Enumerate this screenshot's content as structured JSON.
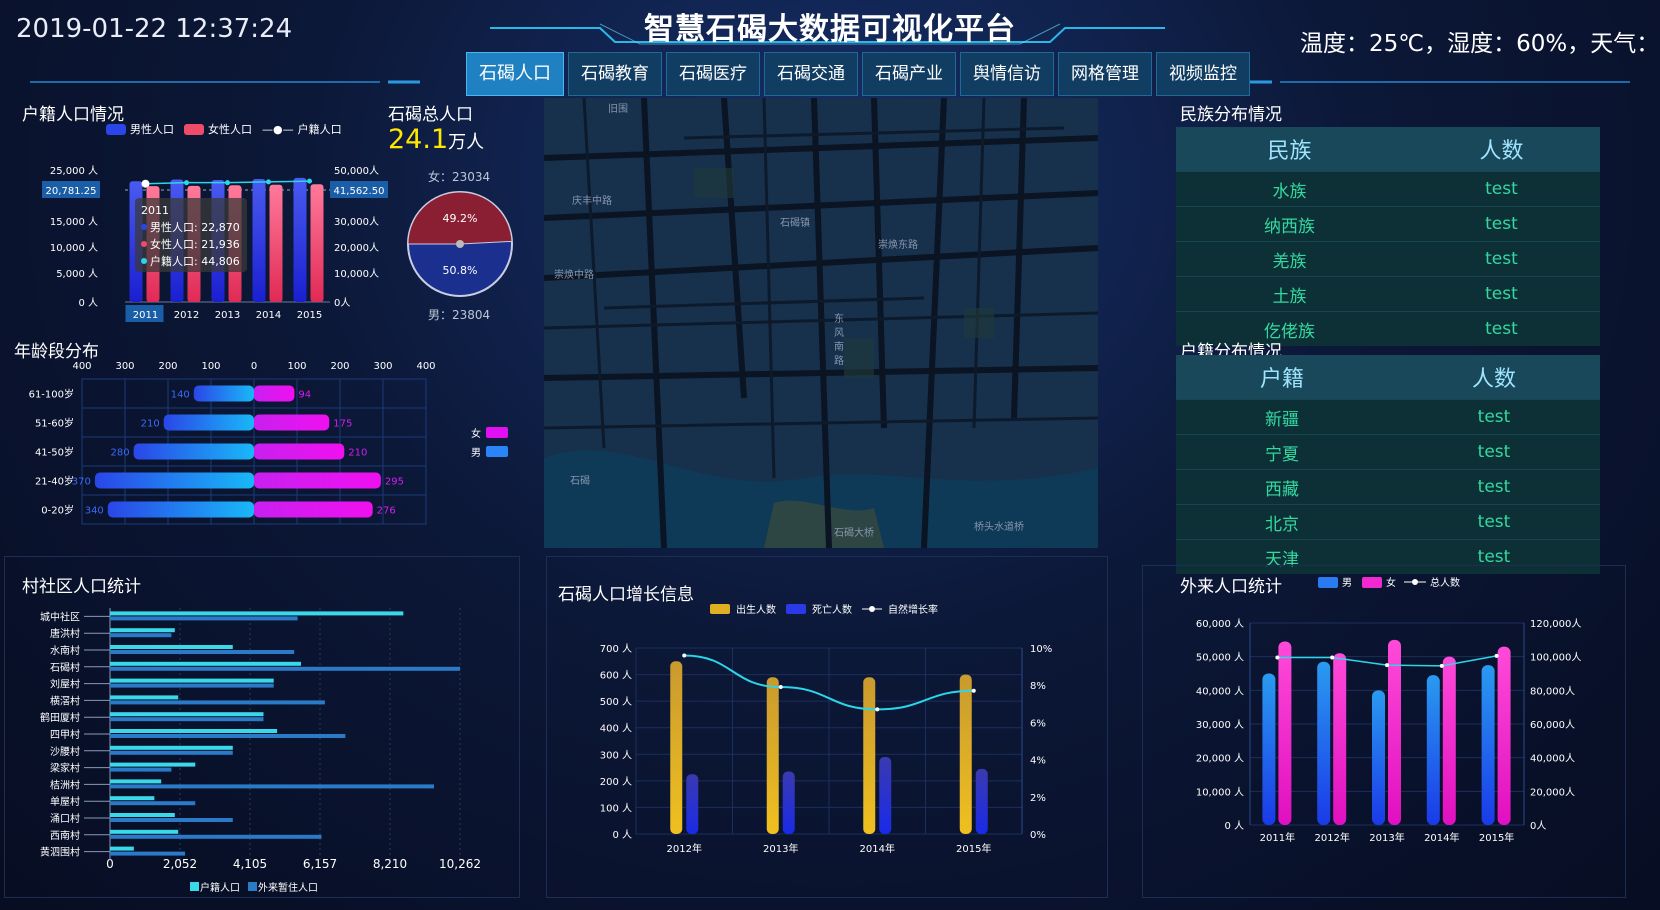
{
  "header": {
    "datetime": "2019-01-22 12:37:24",
    "title": "智慧石碣大数据可视化平台",
    "weather": "温度：25℃，湿度：60%，天气：",
    "tabs": [
      "石碣人口",
      "石碣教育",
      "石碣医疗",
      "石碣交通",
      "石碣产业",
      "舆情信访",
      "网格管理",
      "视频监控"
    ],
    "active_tab": 0
  },
  "colors": {
    "accent": "#1f80c2",
    "male": "#2a46e8",
    "female": "#ef4c6a",
    "cyan": "#2ad6e8",
    "table_green": "#33d9a0"
  },
  "household": {
    "title": "户籍人口情况",
    "legend": [
      "男性人口",
      "女性人口",
      "户籍人口"
    ],
    "left_ticks": [
      "25,000 人",
      "20,781.25",
      "15,000 人",
      "10,000 人",
      "5,000 人",
      "0 人"
    ],
    "right_ticks": [
      "50,000人",
      "41,562.50",
      "30,000人",
      "20,000人",
      "10,000人",
      "0人"
    ],
    "tooltip": {
      "year": "2011",
      "male": "男性人口: 22,870",
      "female": "女性人口: 21,936",
      "total": "户籍人口: 44,806"
    },
    "chart_data": {
      "type": "bar",
      "categories": [
        "2011",
        "2012",
        "2013",
        "2014",
        "2015"
      ],
      "series": [
        {
          "name": "男性人口",
          "values": [
            22870,
            23200,
            23100,
            23300,
            23500
          ]
        },
        {
          "name": "女性人口",
          "values": [
            21936,
            22000,
            22100,
            22200,
            22300
          ]
        },
        {
          "name": "户籍人口",
          "values": [
            44806,
            45200,
            45200,
            45500,
            45800
          ]
        }
      ],
      "ylim": [
        0,
        25000
      ],
      "y2lim": [
        0,
        50000
      ]
    }
  },
  "total_pop": {
    "title": "石碣总人口",
    "value": "24.1",
    "unit": "万人",
    "female_label": "女：23034",
    "male_label": "男：23804",
    "chart_data": {
      "type": "pie",
      "labels": [
        "女",
        "男"
      ],
      "values": [
        49.2,
        50.8
      ],
      "value_labels": [
        "49.2%",
        "50.8%"
      ]
    }
  },
  "age": {
    "title": "年龄段分布",
    "legend": [
      "女",
      "男"
    ],
    "axis_ticks": [
      "400",
      "300",
      "200",
      "100",
      "0",
      "100",
      "200",
      "300",
      "400"
    ],
    "chart_data": {
      "type": "bar",
      "categories": [
        "61-100岁",
        "51-60岁",
        "41-50岁",
        "21-40岁",
        "0-20岁"
      ],
      "series": [
        {
          "name": "男",
          "values": [
            140,
            210,
            280,
            370,
            340
          ]
        },
        {
          "name": "女",
          "values": [
            94,
            175,
            210,
            295,
            276
          ]
        }
      ],
      "xlim": [
        -400,
        400
      ]
    }
  },
  "ethnic": {
    "title": "民族分布情况",
    "headers": [
      "民族",
      "人数"
    ],
    "rows": [
      [
        "水族",
        "test"
      ],
      [
        "纳西族",
        "test"
      ],
      [
        "羌族",
        "test"
      ],
      [
        "土族",
        "test"
      ],
      [
        "仡佬族",
        "test"
      ]
    ]
  },
  "huji": {
    "title": "户籍分布情况",
    "headers": [
      "户籍",
      "人数"
    ],
    "rows": [
      [
        "新疆",
        "test"
      ],
      [
        "宁夏",
        "test"
      ],
      [
        "西藏",
        "test"
      ],
      [
        "北京",
        "test"
      ],
      [
        "天津",
        "test"
      ]
    ]
  },
  "map": {
    "labels": [
      "旧围",
      "庆丰中路",
      "石碣镇",
      "崇焕东路",
      "崇焕中路",
      "东风南路",
      "石碣",
      "石碣大桥",
      "桥头水道桥"
    ]
  },
  "village": {
    "title": "村社区人口统计",
    "legend": [
      "户籍人口",
      "外来暂住人口"
    ],
    "axis_ticks": [
      "0",
      "2,052",
      "4,105",
      "6,157",
      "8,210",
      "10,262"
    ],
    "chart_data": {
      "type": "bar",
      "categories": [
        "城中社区",
        "唐洪村",
        "水南村",
        "石碣村",
        "刘屋村",
        "横滘村",
        "鹤田厦村",
        "四甲村",
        "沙腰村",
        "梁家村",
        "桔洲村",
        "单屋村",
        "涌口村",
        "西南村",
        "黄泗围村"
      ],
      "series": [
        {
          "name": "户籍人口",
          "values": [
            8600,
            1900,
            3600,
            5600,
            4800,
            2000,
            4500,
            4900,
            3600,
            2500,
            1500,
            1300,
            1900,
            2000,
            700
          ]
        },
        {
          "name": "外来暂住人口",
          "values": [
            5500,
            1800,
            5400,
            10262,
            4800,
            6300,
            4500,
            6900,
            3600,
            1800,
            9500,
            2500,
            3600,
            6200,
            2200
          ]
        }
      ],
      "xlim": [
        0,
        10262
      ]
    }
  },
  "growth": {
    "title": "石碣人口增长信息",
    "legend": [
      "出生人数",
      "死亡人数",
      "自然增长率"
    ],
    "left_ticks": [
      "700 人",
      "600 人",
      "500 人",
      "400 人",
      "300 人",
      "200 人",
      "100 人",
      "0 人"
    ],
    "right_ticks": [
      "10%",
      "8%",
      "6%",
      "4%",
      "2%",
      "0%"
    ],
    "chart_data": {
      "type": "bar",
      "categories": [
        "2012年",
        "2013年",
        "2014年",
        "2015年"
      ],
      "series": [
        {
          "name": "出生人数",
          "values": [
            650,
            590,
            590,
            600
          ]
        },
        {
          "name": "死亡人数",
          "values": [
            225,
            235,
            290,
            245
          ]
        },
        {
          "name": "自然增长率",
          "values": [
            9.6,
            7.9,
            6.7,
            7.7
          ]
        }
      ],
      "ylim": [
        0,
        700
      ],
      "y2lim": [
        0,
        10
      ]
    }
  },
  "migrant": {
    "title": "外来人口统计",
    "legend": [
      "男",
      "女",
      "总人数"
    ],
    "left_ticks": [
      "60,000 人",
      "50,000 人",
      "40,000 人",
      "30,000 人",
      "20,000 人",
      "10,000 人",
      "0 人"
    ],
    "right_ticks": [
      "120,000人",
      "100,000人",
      "80,000人",
      "60,000人",
      "40,000人",
      "20,000人",
      "0人"
    ],
    "chart_data": {
      "type": "bar",
      "categories": [
        "2011年",
        "2012年",
        "2013年",
        "2014年",
        "2015年"
      ],
      "series": [
        {
          "name": "男",
          "values": [
            45000,
            48500,
            40000,
            44500,
            47500
          ]
        },
        {
          "name": "女",
          "values": [
            54500,
            51000,
            55000,
            50000,
            53000
          ]
        },
        {
          "name": "总人数",
          "values": [
            99500,
            99500,
            95000,
            94500,
            100500
          ]
        }
      ],
      "ylim": [
        0,
        60000
      ],
      "y2lim": [
        0,
        120000
      ]
    }
  }
}
